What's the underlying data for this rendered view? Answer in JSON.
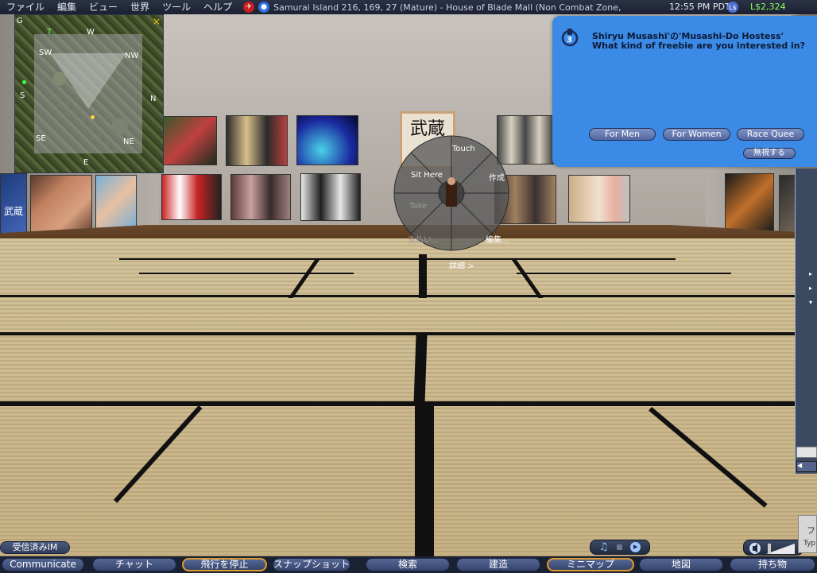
{
  "menubar": {
    "items": [
      "ファイル",
      "編集",
      "ビュー",
      "世界",
      "ツール",
      "ヘルプ"
    ],
    "location": "Samurai Island 216, 169, 27 (Mature) - House of Blade Mall (Non Combat Zone, Shooting",
    "clock": "12:55 PM PDT",
    "balance": "L$2,324",
    "ls_label": "L$"
  },
  "minimap": {
    "labels": {
      "n": "N",
      "nw": "NW",
      "w": "W",
      "sw": "SW",
      "s": "S",
      "se": "SE",
      "e": "E",
      "ne": "NE",
      "g": "G"
    },
    "close": "×",
    "marker_t": "T"
  },
  "pie_menu": {
    "touch": "Touch",
    "sit_here": "Sit Here",
    "create": "作成",
    "take": "Take",
    "pay": "支払い...",
    "edit": "編集...",
    "more": "詳細 >"
  },
  "notification": {
    "title": "Shiryu Musashi'の'Musashi-Do Hostess'",
    "message": "What kind of freebie are you interested in?",
    "buttons": [
      "For Men",
      "For Women",
      "Race Quee"
    ],
    "ignore": "無視する"
  },
  "side_panel": {
    "arrows": [
      "▸",
      "▸",
      "▾"
    ],
    "scroll_left": "◀"
  },
  "im_button": "受信済みIM",
  "typing_box": "Typ",
  "typing_box_char": "フ",
  "media": {
    "music_icon": "♫",
    "stop_icon": "■",
    "play_icon": "▶"
  },
  "toolbar": {
    "communicate": "Communicate",
    "chat": "チャット",
    "stop_flying": "飛行を停止",
    "snapshot": "スナップショット",
    "search": "検索",
    "build": "建造",
    "minimap": "ミニマップ",
    "map": "地図",
    "inventory": "持ち物"
  },
  "scene_text": {
    "kanji": "武蔵",
    "kanji_left": "武蔵"
  },
  "colors": {
    "notice_bg": "#3a8ae6",
    "menubar_bg": "#1b2131",
    "balance": "#8aff5a",
    "active_border": "#e09a2c"
  }
}
